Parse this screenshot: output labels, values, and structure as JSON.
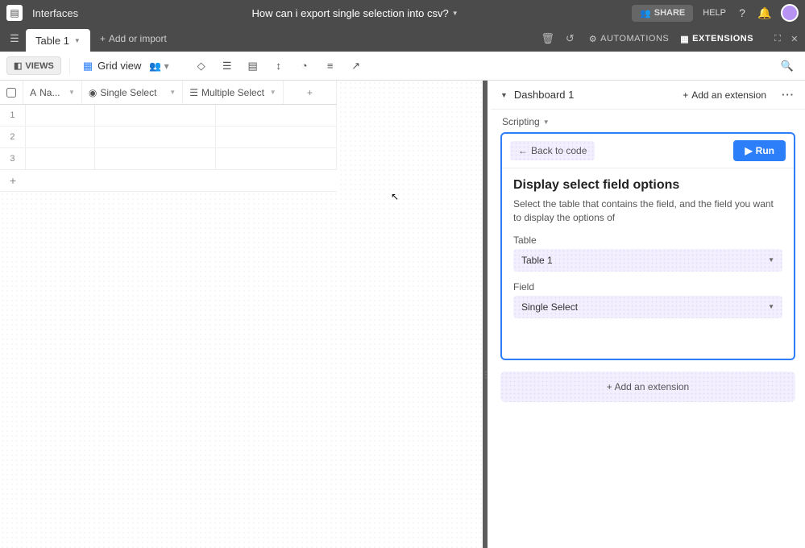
{
  "topbar": {
    "interfaces": "Interfaces",
    "title": "How can i export single selection into csv?",
    "share": "SHARE",
    "help": "HELP"
  },
  "secondbar": {
    "tab1": "Table 1",
    "add_import": "Add or import",
    "automations": "AUTOMATIONS",
    "extensions": "EXTENSIONS"
  },
  "viewbar": {
    "views": "VIEWS",
    "gridview": "Grid view"
  },
  "columns": {
    "name": "Na...",
    "single": "Single Select",
    "multi": "Multiple Select"
  },
  "rows": {
    "r1": "1",
    "r2": "2",
    "r3": "3"
  },
  "ext_panel": {
    "dashboard": "Dashboard 1",
    "add_ext": "Add an extension",
    "scripting": "Scripting",
    "back": "Back to code",
    "run": "Run",
    "heading": "Display select field options",
    "desc": "Select the table that contains the field, and the field you want to display the options of",
    "table_label": "Table",
    "table_value": "Table 1",
    "field_label": "Field",
    "field_value": "Single Select",
    "add_ext_big": "Add an extension"
  }
}
